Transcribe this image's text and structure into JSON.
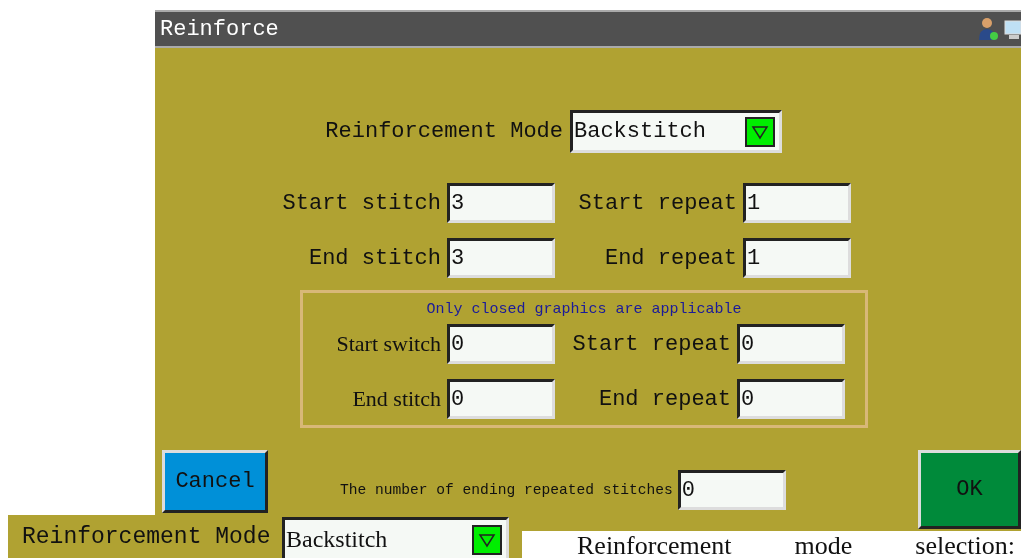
{
  "window": {
    "title": "Reinforce"
  },
  "mode": {
    "label": "Reinforcement Mode",
    "value": "Backstitch"
  },
  "fields": [
    {
      "label": "Start stitch",
      "value": "3"
    },
    {
      "label": "Start repeat",
      "value": "1"
    },
    {
      "label": "End stitch",
      "value": "3"
    },
    {
      "label": "End repeat",
      "value": "1"
    }
  ],
  "group": {
    "note": "Only closed graphics are applicable",
    "fields": [
      {
        "label": "Start switch",
        "value": "0"
      },
      {
        "label": "Start repeat",
        "value": "0"
      },
      {
        "label": "End stitch",
        "value": "0"
      },
      {
        "label": "End repeat",
        "value": "0"
      }
    ]
  },
  "ending": {
    "label": "The number of ending repeated stitches",
    "value": "0"
  },
  "buttons": {
    "cancel": "Cancel",
    "ok": "OK"
  },
  "inset": {
    "label": "Reinforcement Mode",
    "value": "Backstitch"
  },
  "caption": "Reinforcement mode selection:"
}
